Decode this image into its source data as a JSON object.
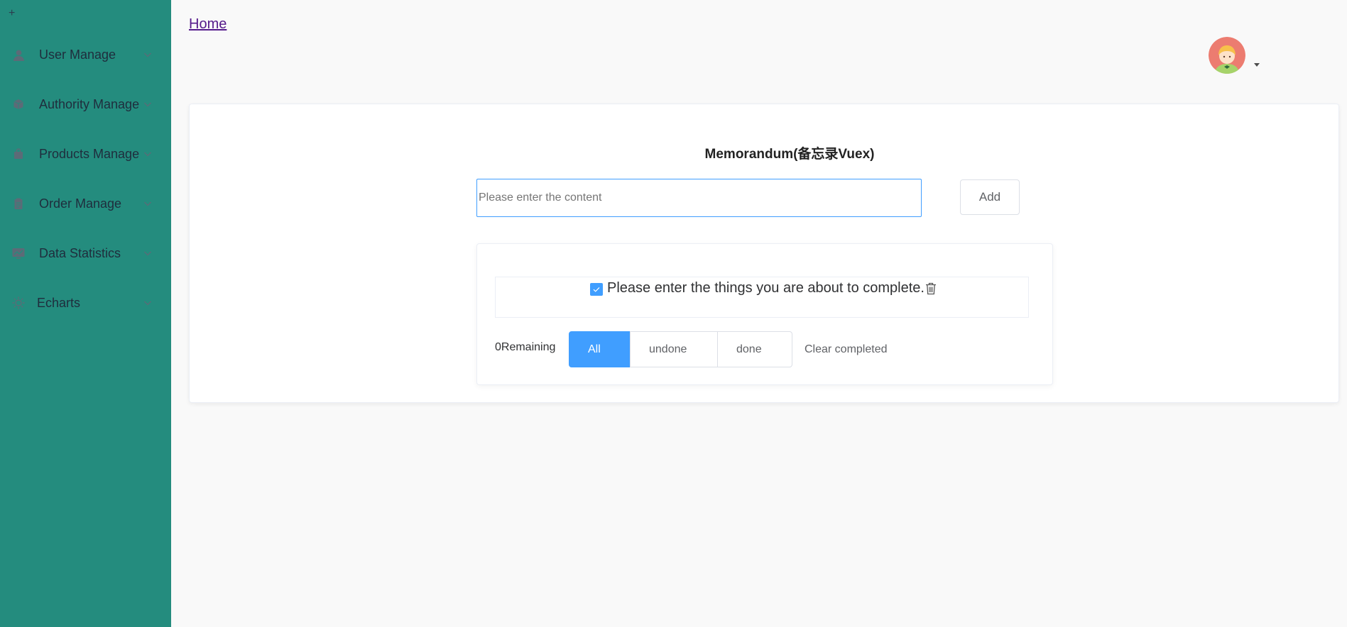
{
  "sidebar": {
    "collapse_symbol": "+",
    "items": [
      {
        "label": "User Manage",
        "icon": "user-icon"
      },
      {
        "label": "Authority Manage",
        "icon": "box-icon"
      },
      {
        "label": "Products Manage",
        "icon": "bag-icon"
      },
      {
        "label": "Order Manage",
        "icon": "clipboard-icon"
      },
      {
        "label": "Data Statistics",
        "icon": "chart-icon"
      },
      {
        "label": "Echarts",
        "icon": "sun-icon"
      }
    ]
  },
  "header": {
    "breadcrumb": "Home",
    "avatar_icon": "avatar-icon"
  },
  "memo": {
    "title": "Memorandum(备忘录Vuex)",
    "input_placeholder": "Please enter the content",
    "input_value": "",
    "add_label": "Add",
    "todos": [
      {
        "text": "Please enter the things you are about to complete.",
        "checked": true
      }
    ],
    "remaining_label": "0Remaining",
    "filters": [
      "All",
      "undone",
      "done"
    ],
    "active_filter": "All",
    "clear_label": "Clear completed"
  },
  "colors": {
    "sidebar_bg": "#248c7e",
    "accent": "#409eff",
    "page_bg": "#f9f9f9"
  }
}
